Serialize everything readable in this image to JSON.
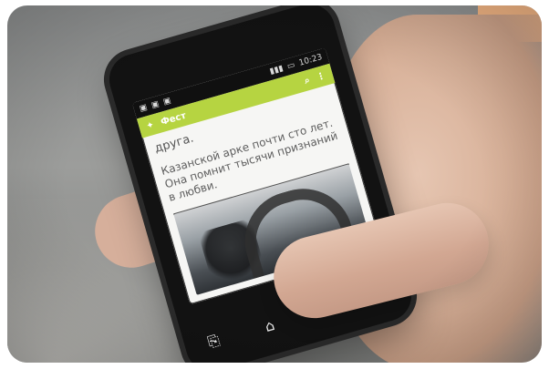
{
  "screen": {
    "statusbar": {
      "time": "10:23"
    },
    "appbar": {
      "title": "Фест"
    },
    "content": {
      "line_top": "друга.",
      "paragraph": "Казанской арке почти сто лет. Она помнит тысячи признаний в любви."
    },
    "icons": {
      "star": "star-icon",
      "share": "share-icon",
      "back": "back-icon",
      "home": "home-icon",
      "recent": "recent-apps-icon",
      "menu": "menu-icon"
    },
    "colors": {
      "app_green": "#b6d441",
      "star_gold": "#e0b02a",
      "corner_accent": "#f1b483"
    }
  }
}
